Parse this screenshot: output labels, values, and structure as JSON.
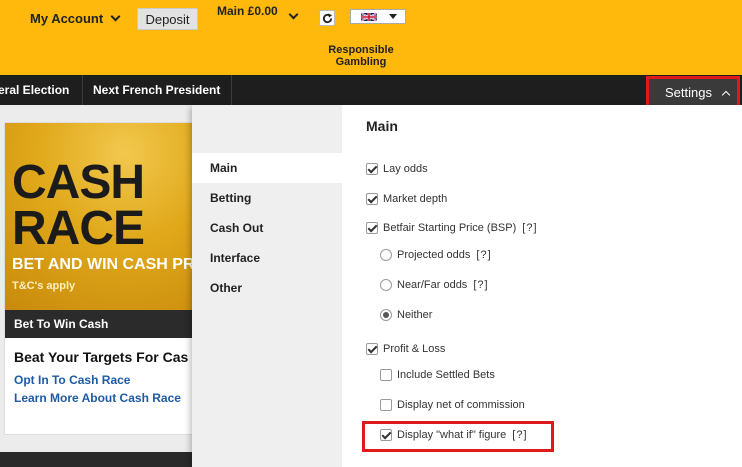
{
  "header": {
    "my_account_label": "My Account",
    "deposit_label": "Deposit",
    "balance_label": "Main £0.00",
    "responsible_label": "Responsible Gambling"
  },
  "nav": {
    "items": [
      "eral Election",
      "Next French President"
    ],
    "settings_label": "Settings"
  },
  "promo": {
    "banner_line1": "CASH",
    "banner_line2": "RACE",
    "banner_sub": "BET AND WIN CASH PR",
    "banner_tc": "T&C's apply",
    "bar_label": "Bet To Win Cash",
    "title": "Beat Your Targets For Cas",
    "links": [
      "Opt In To Cash Race",
      "Learn More About Cash Race"
    ]
  },
  "settings": {
    "heading": "Main",
    "side_items": [
      "Main",
      "Betting",
      "Cash Out",
      "Interface",
      "Other"
    ],
    "active_side_item": "Main",
    "help_label": "[?]",
    "options": {
      "lay_odds": "Lay odds",
      "market_depth": "Market depth",
      "bsp": "Betfair Starting Price (BSP)",
      "projected_odds": "Projected odds",
      "near_far_odds": "Near/Far odds",
      "neither": "Neither",
      "profit_loss": "Profit & Loss",
      "include_settled": "Include Settled Bets",
      "net_commission": "Display net of commission",
      "what_if": "Display \"what if\" figure"
    },
    "state": {
      "lay_odds": true,
      "market_depth": true,
      "bsp": true,
      "odds_display": "neither",
      "profit_loss": true,
      "include_settled": false,
      "net_commission": false,
      "what_if": true
    }
  },
  "colors": {
    "header_yellow": "#ffb80c",
    "nav_dark": "#1e1e1e",
    "highlight_red": "#e0191c",
    "link_blue": "#1e5aa5"
  },
  "icons": {
    "refresh": "refresh-icon",
    "flag": "uk-flag-icon"
  }
}
